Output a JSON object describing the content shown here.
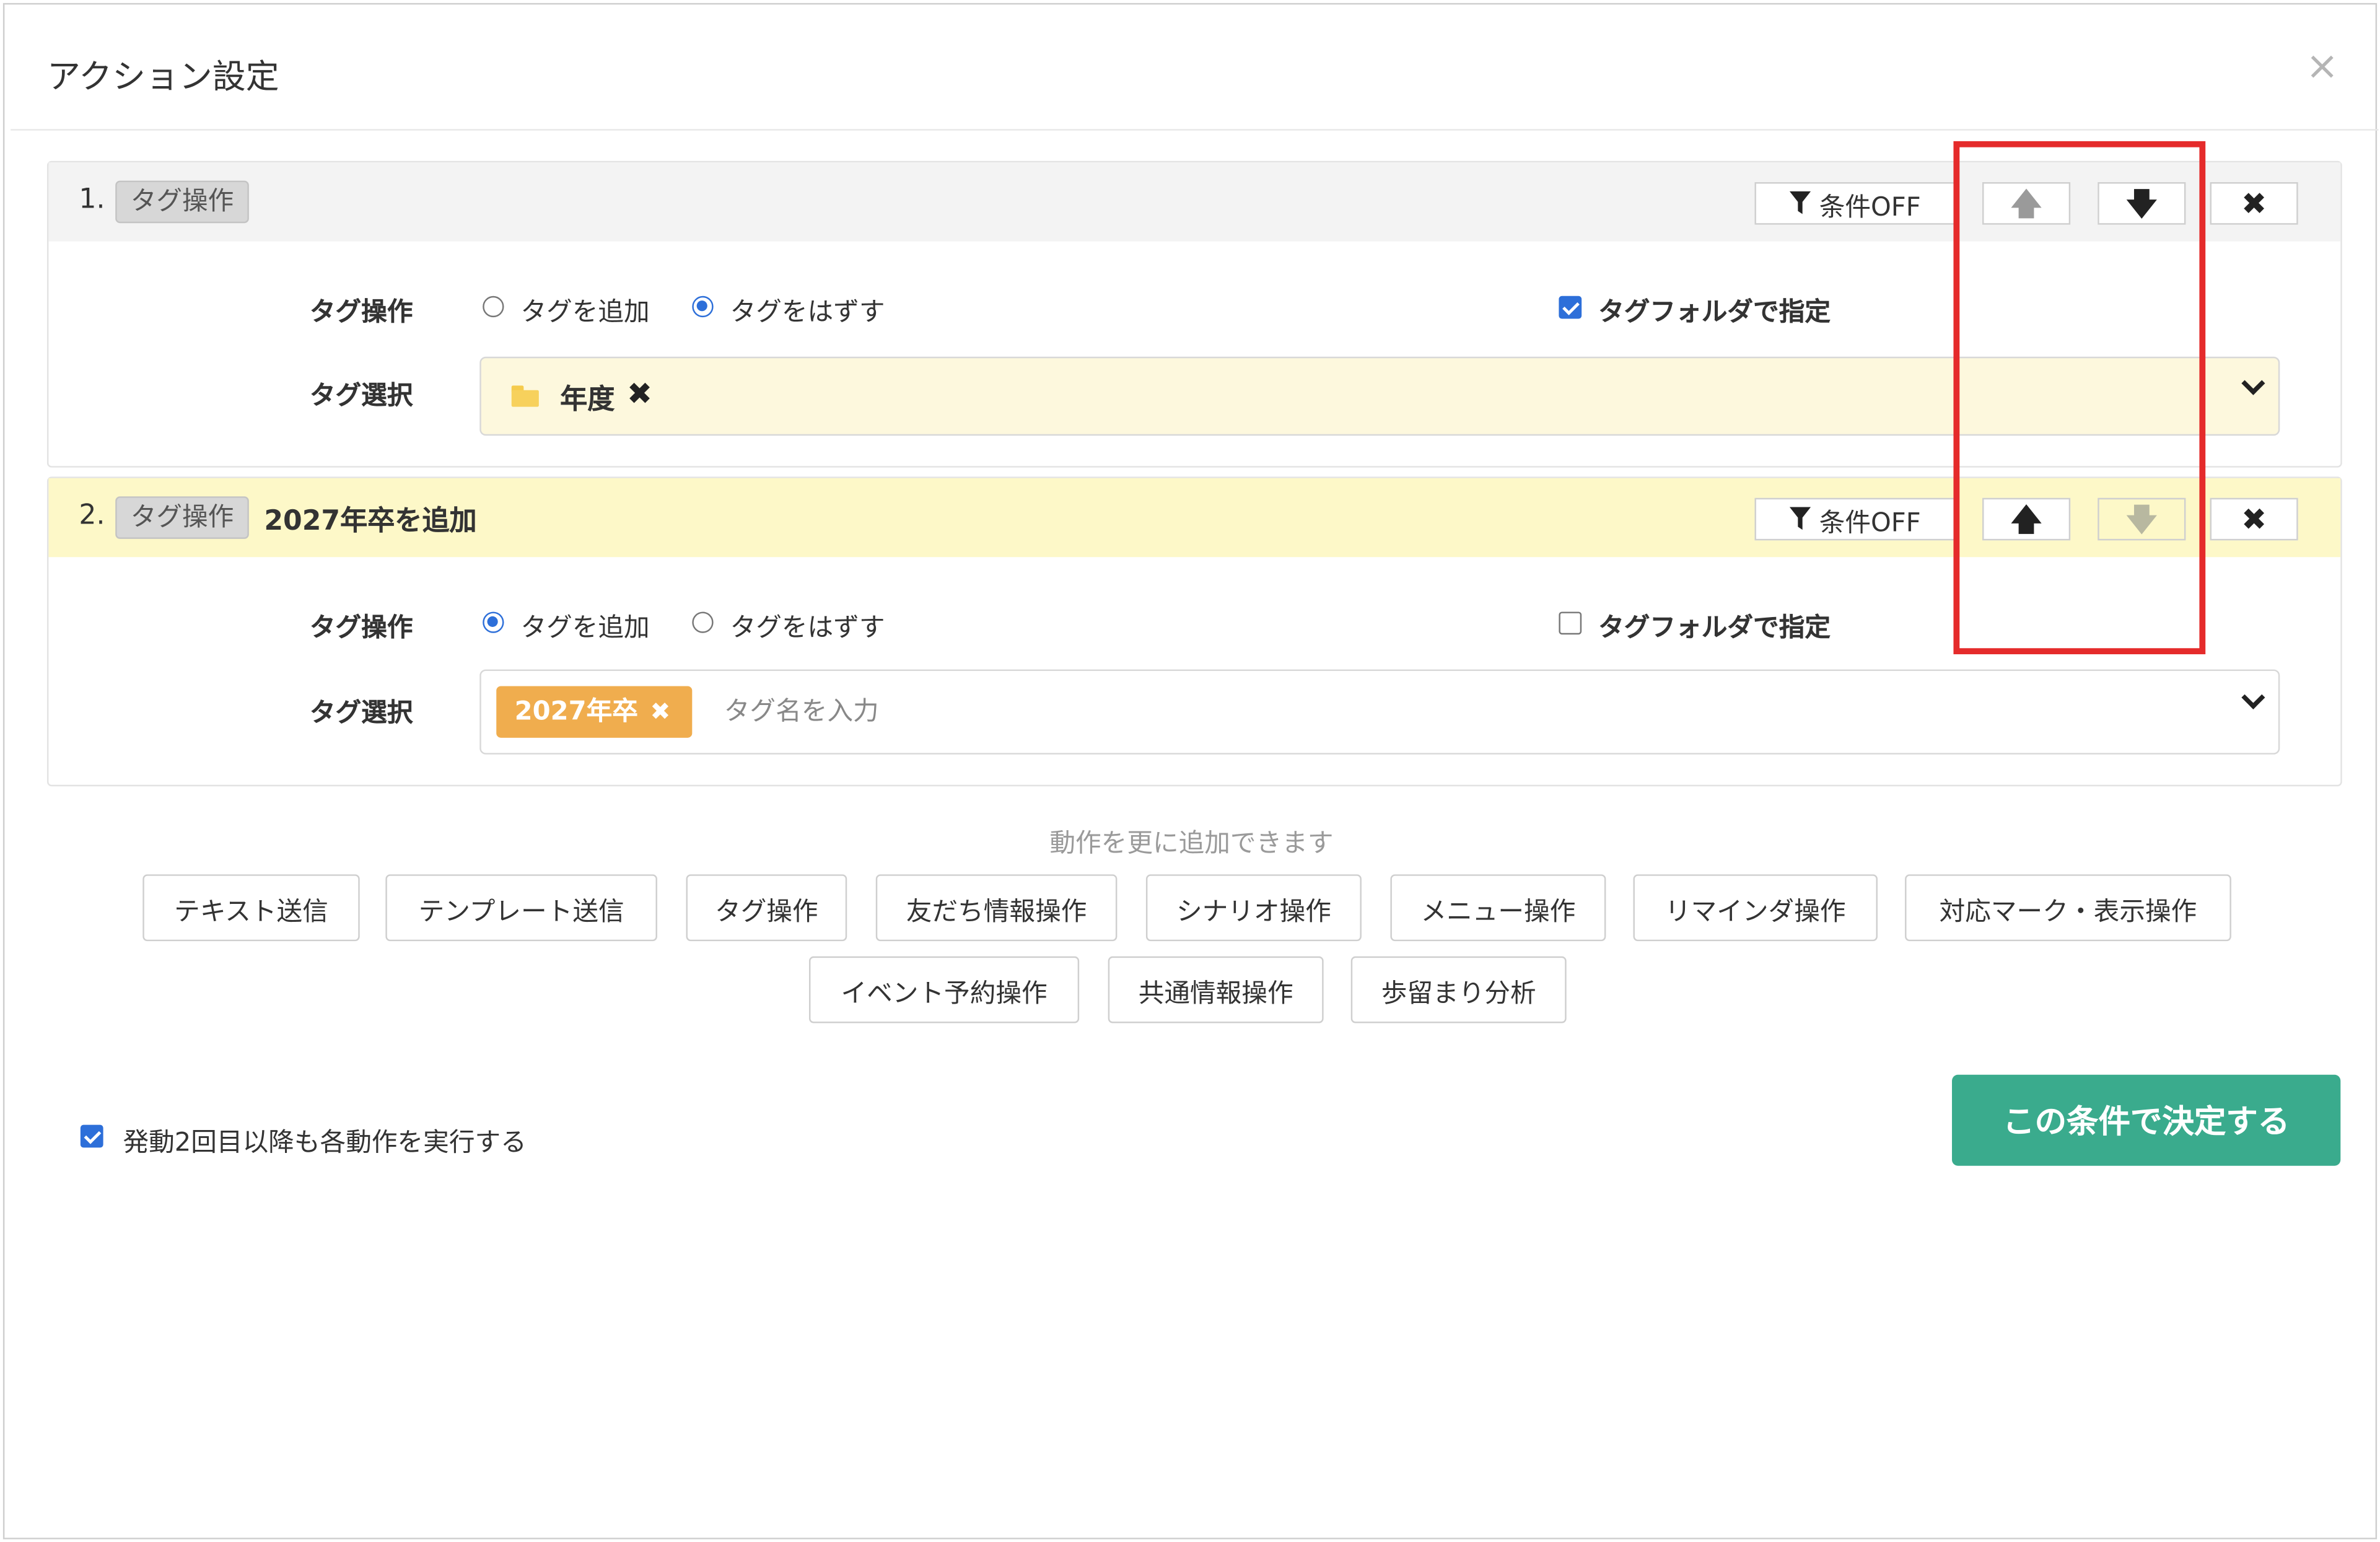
{
  "modal": {
    "title": "アクション設定",
    "close_symbol": "×"
  },
  "actions": [
    {
      "number": "1.",
      "badge": "タグ操作",
      "title": "",
      "condition_button": "条件OFF",
      "up_arrow_enabled": false,
      "down_arrow_enabled": true,
      "delete_symbol": "✖",
      "tag_operation_label": "タグ操作",
      "options": [
        "タグを追加",
        "タグをはずす"
      ],
      "selected_option": "タグをはずす",
      "folder_checkbox_label": "タグフォルダで指定",
      "folder_checkbox_checked": true,
      "tag_select_label": "タグ選択",
      "selected_folder": "年度",
      "remove_symbol": "✖"
    },
    {
      "number": "2.",
      "badge": "タグ操作",
      "title": "2027年卒を追加",
      "condition_button": "条件OFF",
      "up_arrow_enabled": true,
      "down_arrow_enabled": false,
      "delete_symbol": "✖",
      "tag_operation_label": "タグ操作",
      "options": [
        "タグを追加",
        "タグをはずす"
      ],
      "selected_option": "タグを追加",
      "folder_checkbox_label": "タグフォルダで指定",
      "folder_checkbox_checked": false,
      "tag_select_label": "タグ選択",
      "selected_tag": "2027年卒",
      "chip_remove_symbol": "✖",
      "tag_input_placeholder": "タグ名を入力"
    }
  ],
  "add_actions": {
    "hint": "動作を更に追加できます",
    "buttons_row1": [
      "テキスト送信",
      "テンプレート送信",
      "タグ操作",
      "友だち情報操作",
      "シナリオ操作",
      "メニュー操作",
      "リマインダ操作",
      "対応マーク・表示操作"
    ],
    "buttons_row2": [
      "イベント予約操作",
      "共通情報操作",
      "歩留まり分析"
    ]
  },
  "footer": {
    "repeat_checkbox_label": "発動2回目以降も各動作を実行する",
    "repeat_checkbox_checked": true,
    "submit_label": "この条件で決定する"
  },
  "icons": {
    "filter": "filter-icon",
    "up": "arrow-up-icon",
    "down": "arrow-down-icon",
    "delete": "close-icon",
    "folder": "folder-icon",
    "chevron": "chevron-down-icon"
  },
  "colors": {
    "accent_blue": "#2d6fd9",
    "submit_green": "#3aab8d",
    "tag_chip_orange": "#f0ad4e",
    "highlight_red": "#e52b2b",
    "panel2_header": "#fdf8c8",
    "folder_select_bg": "#fdf8dd"
  }
}
